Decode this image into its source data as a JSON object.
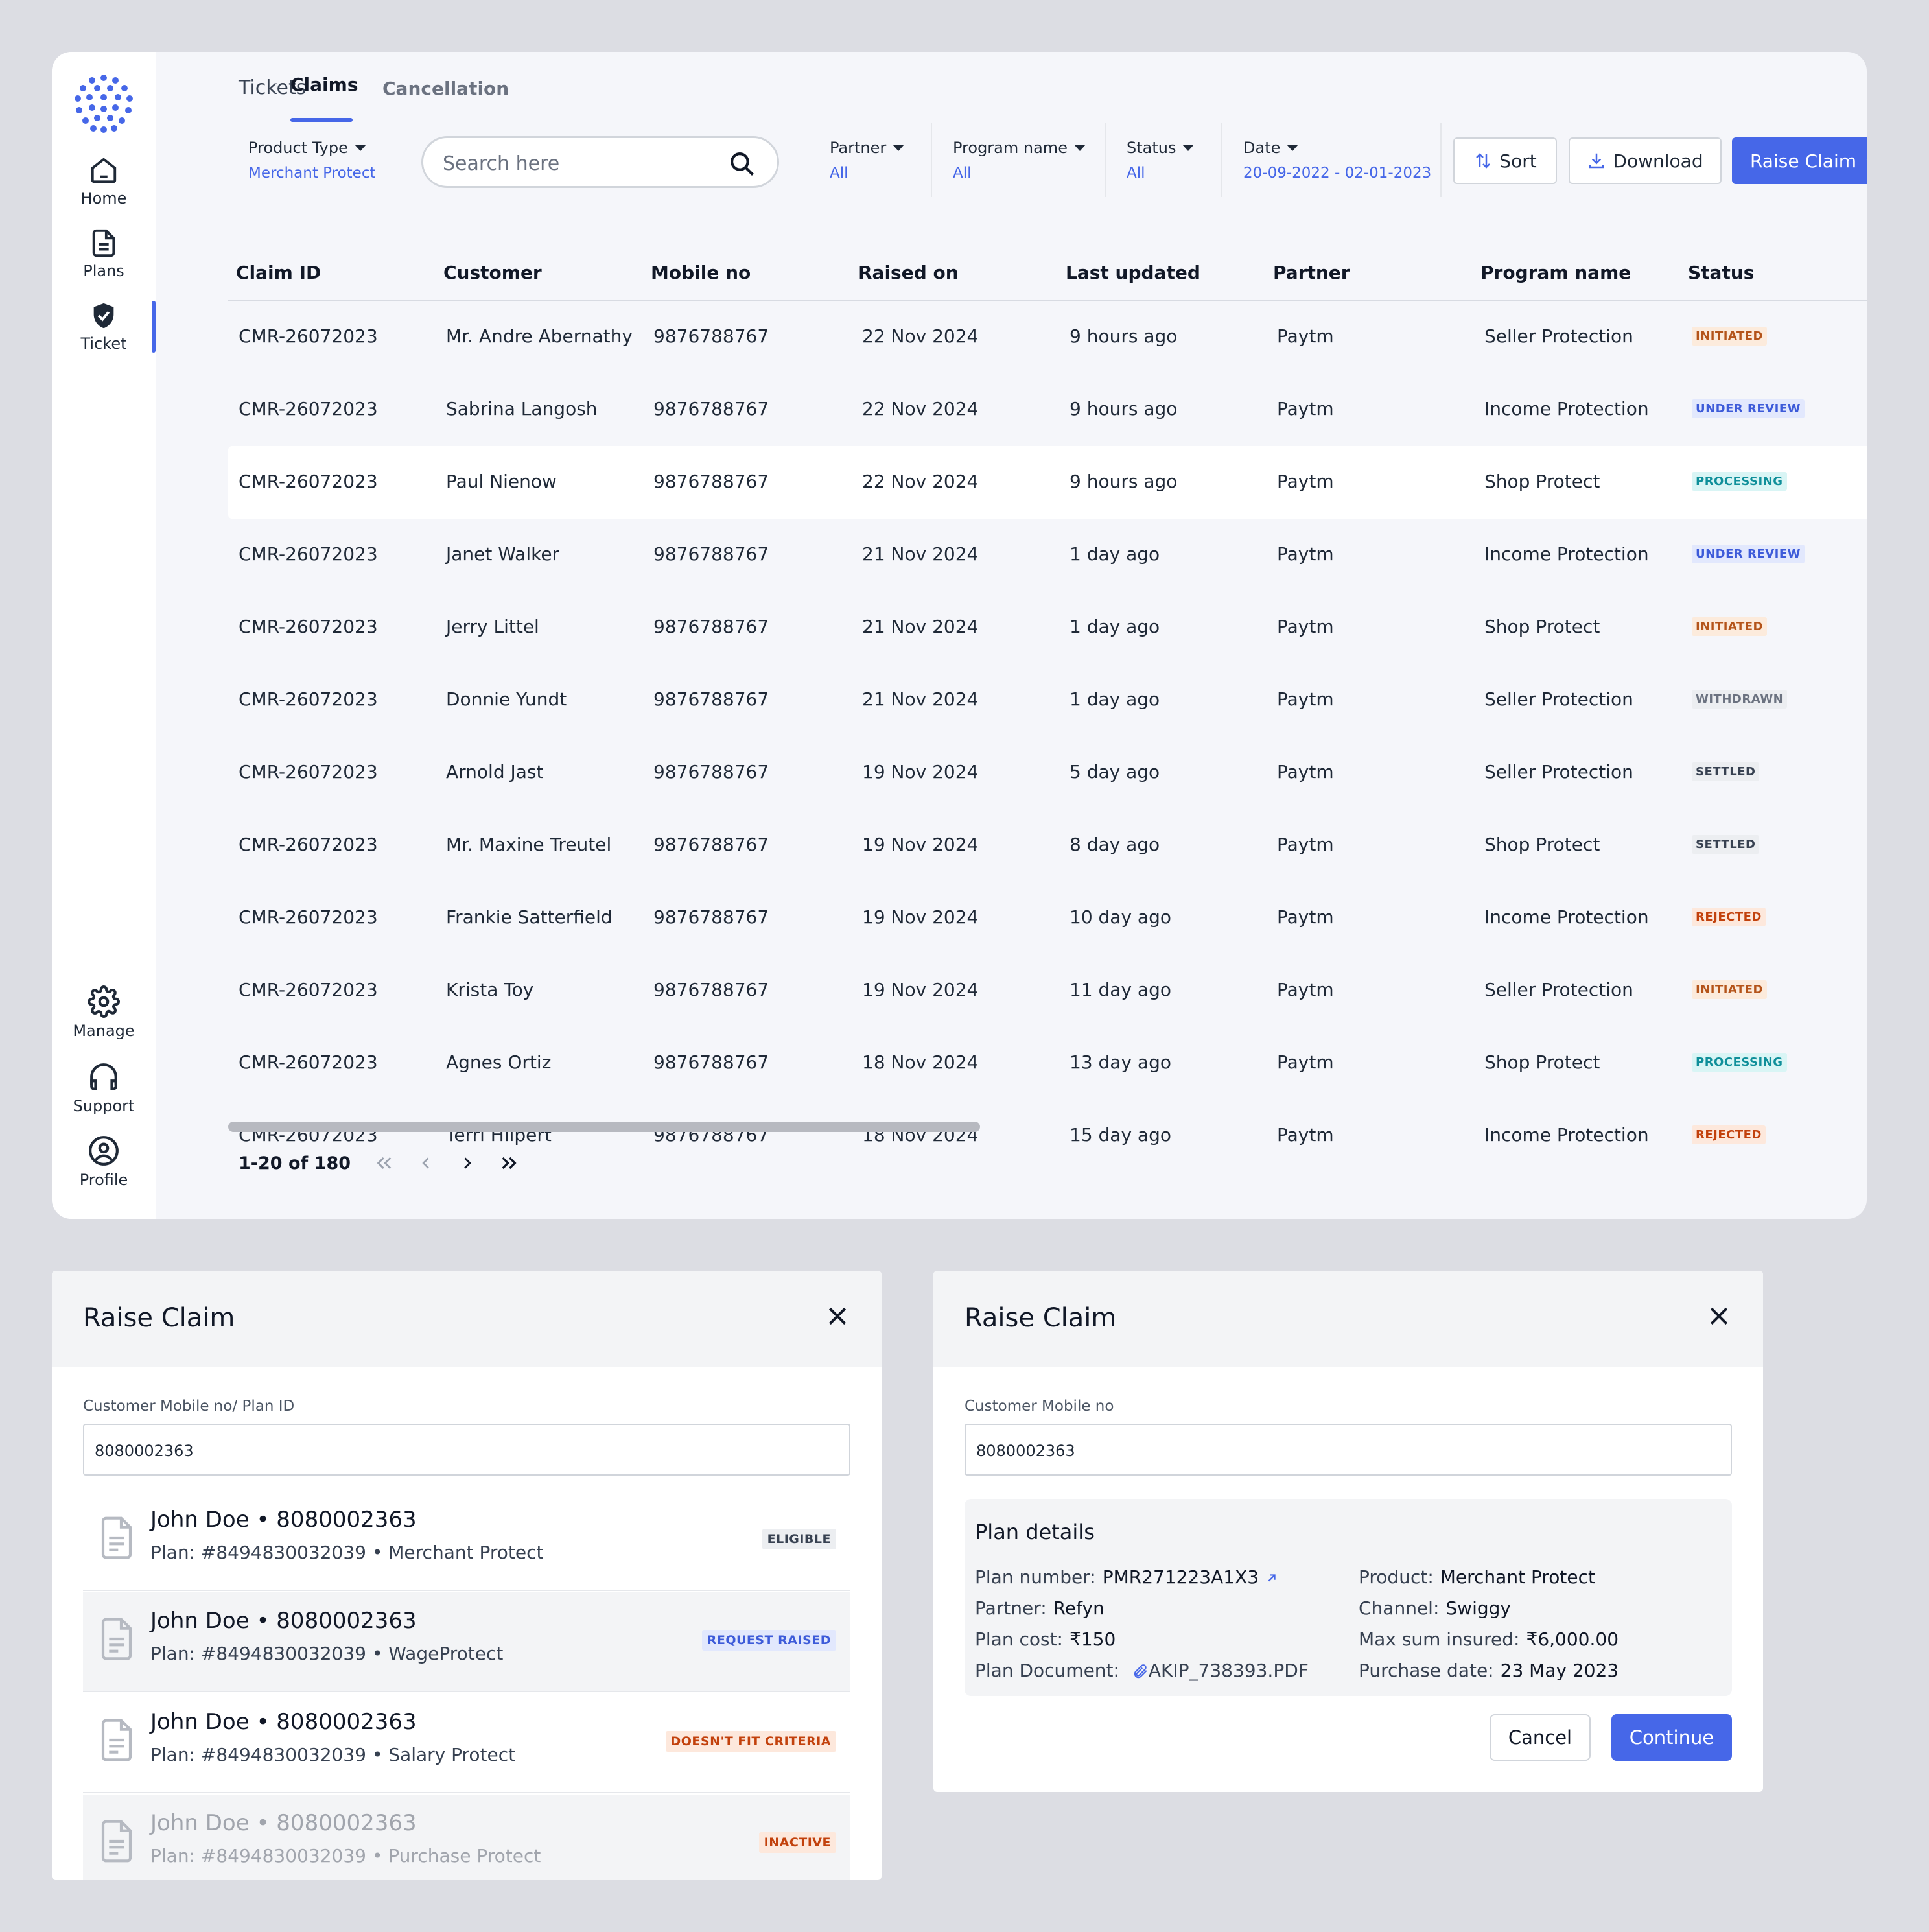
{
  "nav": {
    "items": [
      {
        "label": "Home",
        "icon": "home-icon"
      },
      {
        "label": "Plans",
        "icon": "document-icon"
      },
      {
        "label": "Ticket",
        "icon": "shield-check-icon"
      },
      {
        "label": "Manage",
        "icon": "gear-icon"
      },
      {
        "label": "Support",
        "icon": "headphones-icon"
      },
      {
        "label": "Profile",
        "icon": "user-circle-icon"
      }
    ],
    "active": "Ticket"
  },
  "tabs": [
    {
      "label": "Tickets"
    },
    {
      "label": "Claims",
      "active": true
    },
    {
      "label": "Cancellation"
    }
  ],
  "filters": {
    "product_type": {
      "label": "Product Type",
      "value": "Merchant Protect"
    },
    "search": {
      "placeholder": "Search here"
    },
    "partner": {
      "label": "Partner",
      "value": "All"
    },
    "program_name": {
      "label": "Program name",
      "value": "All"
    },
    "status": {
      "label": "Status",
      "value": "All"
    },
    "date": {
      "label": "Date",
      "value": "20-09-2022 - 02-01-2023"
    }
  },
  "toolbar": {
    "sort": "Sort",
    "download": "Download",
    "raise_claim": "Raise Claim"
  },
  "table": {
    "columns": [
      "Claim ID",
      "Customer",
      "Mobile no",
      "Raised on",
      "Last updated",
      "Partner",
      "Program name",
      "Status"
    ],
    "rows": [
      {
        "claim_id": "CMR-26072023",
        "customer": "Mr. Andre Abernathy",
        "mobile": "9876788767",
        "raised": "22 Nov 2024",
        "updated": "9 hours ago",
        "partner": "Paytm",
        "program": "Seller Protection",
        "status": "INITIATED"
      },
      {
        "claim_id": "CMR-26072023",
        "customer": "Sabrina Langosh",
        "mobile": "9876788767",
        "raised": "22 Nov 2024",
        "updated": "9 hours ago",
        "partner": "Paytm",
        "program": "Income Protection",
        "status": "UNDER REVIEW"
      },
      {
        "claim_id": "CMR-26072023",
        "customer": "Paul Nienow",
        "mobile": "9876788767",
        "raised": "22 Nov 2024",
        "updated": "9 hours ago",
        "partner": "Paytm",
        "program": "Shop Protect",
        "status": "PROCESSING"
      },
      {
        "claim_id": "CMR-26072023",
        "customer": "Janet Walker",
        "mobile": "9876788767",
        "raised": "21 Nov 2024",
        "updated": "1 day ago",
        "partner": "Paytm",
        "program": "Income Protection",
        "status": "UNDER REVIEW"
      },
      {
        "claim_id": "CMR-26072023",
        "customer": "Jerry Littel",
        "mobile": "9876788767",
        "raised": "21 Nov 2024",
        "updated": "1 day ago",
        "partner": "Paytm",
        "program": "Shop Protect",
        "status": "INITIATED"
      },
      {
        "claim_id": "CMR-26072023",
        "customer": "Donnie Yundt",
        "mobile": "9876788767",
        "raised": "21 Nov 2024",
        "updated": "1 day ago",
        "partner": "Paytm",
        "program": "Seller Protection",
        "status": "WITHDRAWN"
      },
      {
        "claim_id": "CMR-26072023",
        "customer": "Arnold Jast",
        "mobile": "9876788767",
        "raised": "19 Nov 2024",
        "updated": "5 day ago",
        "partner": "Paytm",
        "program": "Seller Protection",
        "status": "SETTLED"
      },
      {
        "claim_id": "CMR-26072023",
        "customer": "Mr. Maxine Treutel",
        "mobile": "9876788767",
        "raised": "19 Nov 2024",
        "updated": "8 day ago",
        "partner": "Paytm",
        "program": "Shop Protect",
        "status": "SETTLED"
      },
      {
        "claim_id": "CMR-26072023",
        "customer": "Frankie Satterfield",
        "mobile": "9876788767",
        "raised": "19 Nov 2024",
        "updated": "10 day ago",
        "partner": "Paytm",
        "program": "Income Protection",
        "status": "REJECTED"
      },
      {
        "claim_id": "CMR-26072023",
        "customer": "Krista Toy",
        "mobile": "9876788767",
        "raised": "19 Nov 2024",
        "updated": "11 day ago",
        "partner": "Paytm",
        "program": "Seller Protection",
        "status": "INITIATED"
      },
      {
        "claim_id": "CMR-26072023",
        "customer": "Agnes Ortiz",
        "mobile": "9876788767",
        "raised": "18 Nov 2024",
        "updated": "13 day ago",
        "partner": "Paytm",
        "program": "Shop Protect",
        "status": "PROCESSING"
      },
      {
        "claim_id": "CMR-26072023",
        "customer": "Terri Hilpert",
        "mobile": "9876788767",
        "raised": "18 Nov 2024",
        "updated": "15 day ago",
        "partner": "Paytm",
        "program": "Income Protection",
        "status": "REJECTED"
      }
    ]
  },
  "status_colors": {
    "INITIATED": {
      "fg": "#b4541a",
      "bg": "#fcebdc"
    },
    "UNDER REVIEW": {
      "fg": "#3d5bd9",
      "bg": "#e2e8fd"
    },
    "PROCESSING": {
      "fg": "#0f8f9a",
      "bg": "#d9f5f5"
    },
    "WITHDRAWN": {
      "fg": "#6b7280",
      "bg": "#eceef1"
    },
    "SETTLED": {
      "fg": "#374151",
      "bg": "#eceef1"
    },
    "REJECTED": {
      "fg": "#c2410c",
      "bg": "#fde8dc"
    }
  },
  "pagination": {
    "text": "1-20 of 180"
  },
  "modal1": {
    "title": "Raise Claim",
    "field_label": "Customer Mobile no/ Plan ID",
    "field_value": "8080002363",
    "plans": [
      {
        "name": "John Doe • 8080002363",
        "detail": "Plan: #8494830032039 • Merchant Protect",
        "badge": "ELIGIBLE",
        "fg": "#374151",
        "bg": "#eceef1"
      },
      {
        "name": "John Doe • 8080002363",
        "detail": "Plan: #8494830032039 • WageProtect",
        "badge": "REQUEST RAISED",
        "fg": "#3d5bd9",
        "bg": "#e2e8fd"
      },
      {
        "name": "John Doe • 8080002363",
        "detail": "Plan: #8494830032039 • Salary Protect",
        "badge": "DOESN'T FIT CRITERIA",
        "fg": "#c2410c",
        "bg": "#fde8dc"
      },
      {
        "name": "John Doe • 8080002363",
        "detail": "Plan: #8494830032039 • Purchase Protect",
        "badge": "INACTIVE",
        "fg": "#c2410c",
        "bg": "#fde8dc"
      }
    ]
  },
  "modal2": {
    "title": "Raise Claim",
    "field_label": "Customer Mobile no",
    "field_value": "8080002363",
    "plan_details": {
      "title": "Plan details",
      "left": [
        {
          "k": "Plan number:",
          "v": "PMR271223A1X3"
        },
        {
          "k": "Partner:",
          "v": "Refyn"
        },
        {
          "k": "Plan cost:",
          "v": "₹150"
        },
        {
          "k": "Plan Document:",
          "v": "AKIP_738393.PDF"
        }
      ],
      "right": [
        {
          "k": "Product:",
          "v": "Merchant Protect"
        },
        {
          "k": "Channel:",
          "v": "Swiggy"
        },
        {
          "k": "Max sum insured:",
          "v": "₹6,000.00"
        },
        {
          "k": "Purchase date:",
          "v": "23 May 2023"
        }
      ]
    },
    "cancel": "Cancel",
    "continue": "Continue"
  }
}
